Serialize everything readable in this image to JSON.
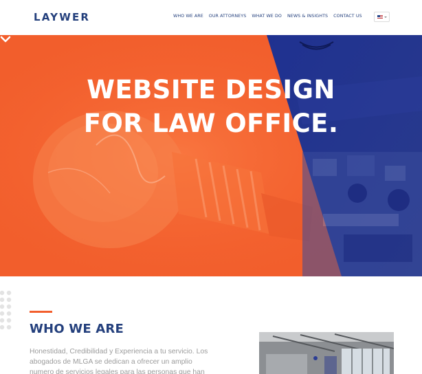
{
  "header": {
    "logo": "LAYWER",
    "nav": [
      "WHO WE ARE",
      "OUR ATTORNEYS",
      "WHAT WE DO",
      "NEWS & INSIGHTS",
      "CONTACT US"
    ],
    "language_flag": "us-flag-icon"
  },
  "hero": {
    "title_line1": "WEBSITE DESIGN",
    "title_line2": "FOR LAW OFFICE.",
    "scroll_icon": "chevron-down-icon"
  },
  "who_we_are": {
    "heading": "WHO WE ARE",
    "body": "Honestidad, Credibilidad y Experiencia a tu servicio. Los abogados de MLGA se dedican a ofrecer un amplio numero de servicios legales para las personas que han"
  },
  "colors": {
    "brand_blue": "#233f7c",
    "accent_orange": "#f25e2c",
    "hero_blue": "#2b3c94",
    "body_text": "#9b9b9b"
  }
}
